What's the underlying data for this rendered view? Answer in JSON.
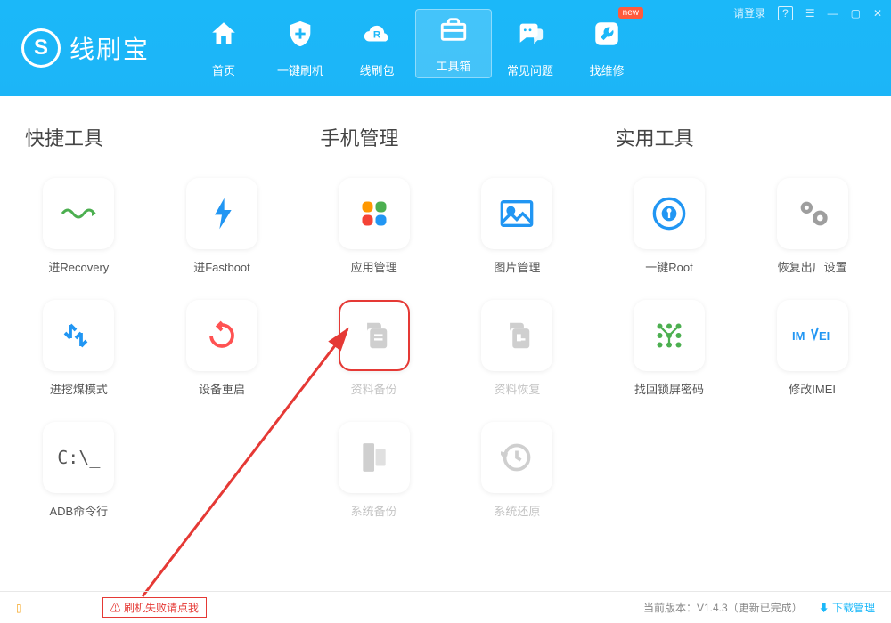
{
  "header": {
    "logo_text": "线刷宝",
    "login_text": "请登录",
    "nav": [
      {
        "label": "首页"
      },
      {
        "label": "一键刷机"
      },
      {
        "label": "线刷包"
      },
      {
        "label": "工具箱"
      },
      {
        "label": "常见问题"
      },
      {
        "label": "找维修",
        "badge": "new"
      }
    ]
  },
  "sections": {
    "quick": {
      "title": "快捷工具",
      "items": [
        {
          "label": "进Recovery"
        },
        {
          "label": "进Fastboot"
        },
        {
          "label": "进挖煤模式"
        },
        {
          "label": "设备重启"
        },
        {
          "label": "ADB命令行"
        }
      ]
    },
    "phone": {
      "title": "手机管理",
      "items": [
        {
          "label": "应用管理"
        },
        {
          "label": "图片管理"
        },
        {
          "label": "资料备份"
        },
        {
          "label": "资料恢复"
        },
        {
          "label": "系统备份"
        },
        {
          "label": "系统还原"
        }
      ]
    },
    "util": {
      "title": "实用工具",
      "items": [
        {
          "label": "一键Root"
        },
        {
          "label": "恢复出厂设置"
        },
        {
          "label": "找回锁屏密码"
        },
        {
          "label": "修改IMEI"
        }
      ]
    }
  },
  "footer": {
    "failure_notice": "刷机失败请点我",
    "version": "当前版本：V1.4.3（更新已完成）",
    "download_manager": "下载管理"
  }
}
